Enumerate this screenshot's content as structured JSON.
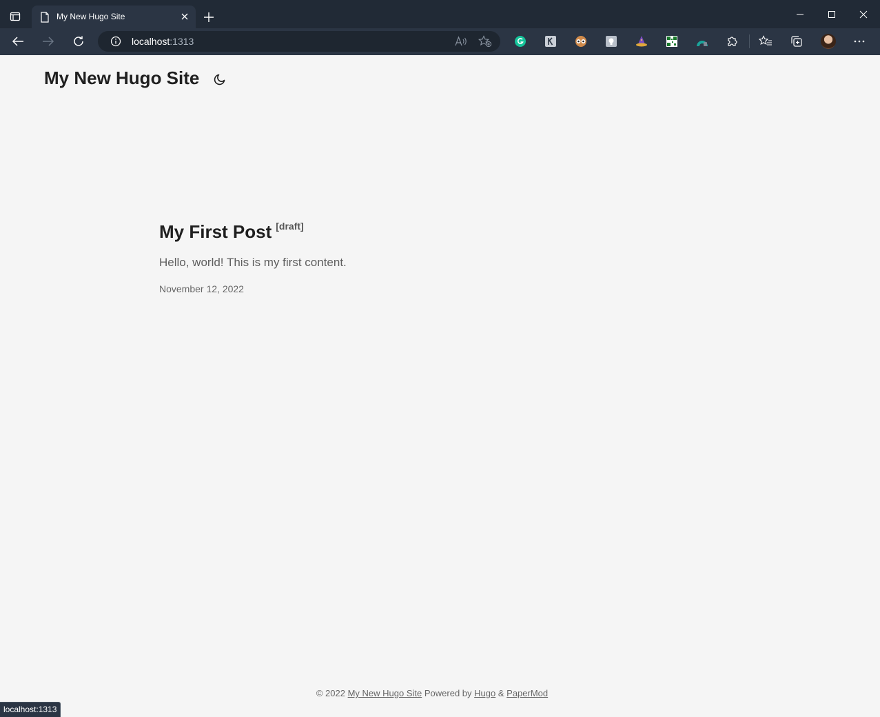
{
  "browser": {
    "tab_title": "My New Hugo Site",
    "url_host": "localhost",
    "url_port": ":1313",
    "status_bar_text": "localhost:1313",
    "accent": "#2b3544"
  },
  "site": {
    "title": "My New Hugo Site"
  },
  "post": {
    "title": "My First Post",
    "draft_label": "[draft]",
    "summary": "Hello, world! This is my first content.",
    "date": "November 12, 2022"
  },
  "footer": {
    "copyright": "© 2022",
    "site_link": "My New Hugo Site",
    "powered_by": "Powered by",
    "hugo_link": "Hugo",
    "amp": "&",
    "papermod_link": "PaperMod"
  },
  "icons": [
    "tab-actions-icon",
    "page-icon",
    "close-icon",
    "plus-icon",
    "minimize-icon",
    "maximize-icon",
    "window-close-icon",
    "back-icon",
    "forward-icon",
    "refresh-icon",
    "info-icon",
    "read-aloud-icon",
    "add-favorite-icon",
    "grammarly-icon",
    "extension-icons",
    "puzzle-icon",
    "favorites-icon",
    "collections-icon",
    "avatar",
    "more-icon",
    "moon-icon"
  ]
}
